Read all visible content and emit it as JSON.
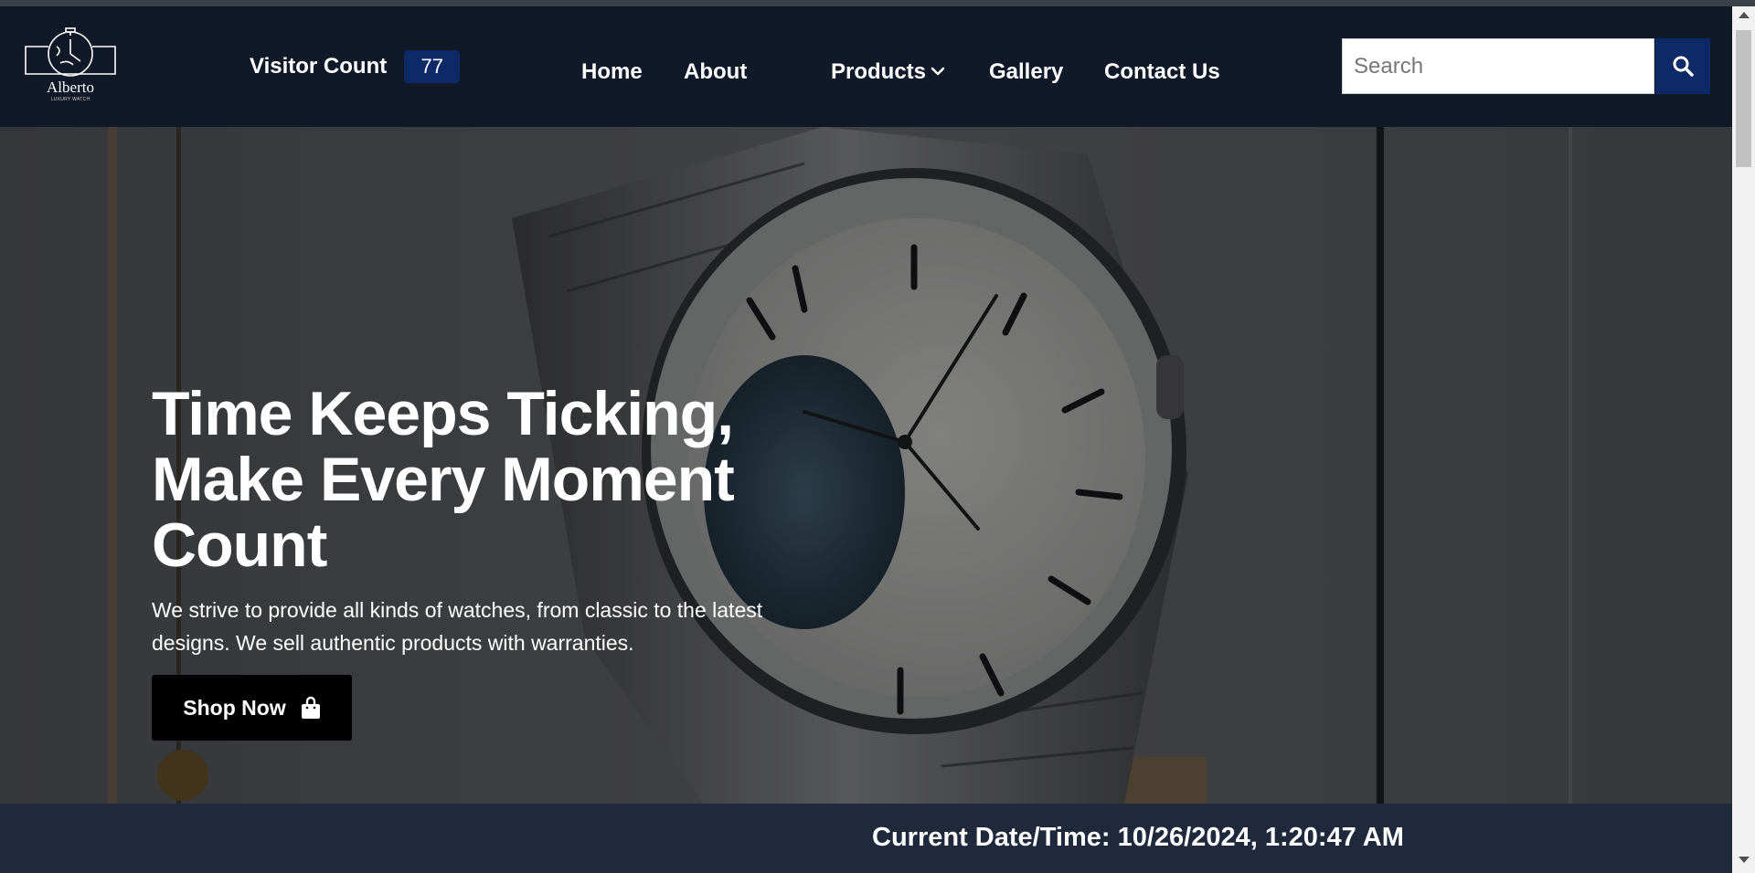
{
  "brand": {
    "name": "Alberto",
    "tagline": "LUXURY WATCH"
  },
  "visitor": {
    "label": "Visitor Count",
    "count": "77"
  },
  "nav": {
    "home": "Home",
    "about": "About",
    "products": "Products",
    "gallery": "Gallery",
    "contact": "Contact Us"
  },
  "search": {
    "placeholder": "Search",
    "value": ""
  },
  "hero": {
    "title_line1": "Time Keeps Ticking,",
    "title_line2": "Make Every Moment",
    "title_line3": "Count",
    "description_line1": "We strive to provide all kinds of watches, from classic to the latest",
    "description_line2": "designs. We sell authentic products with warranties.",
    "button_label": "Shop Now"
  },
  "footer": {
    "datetime": "Current Date/Time: 10/26/2024, 1:20:47 AM"
  },
  "icons": {
    "search": "search-icon",
    "products_dropdown": "chevron-down-icon",
    "shop": "shopping-bag-icon"
  },
  "colors": {
    "navbar_bg": "#111827",
    "accent": "#0d2a66",
    "footer_bg": "#1f293b",
    "button_bg": "#000000"
  }
}
